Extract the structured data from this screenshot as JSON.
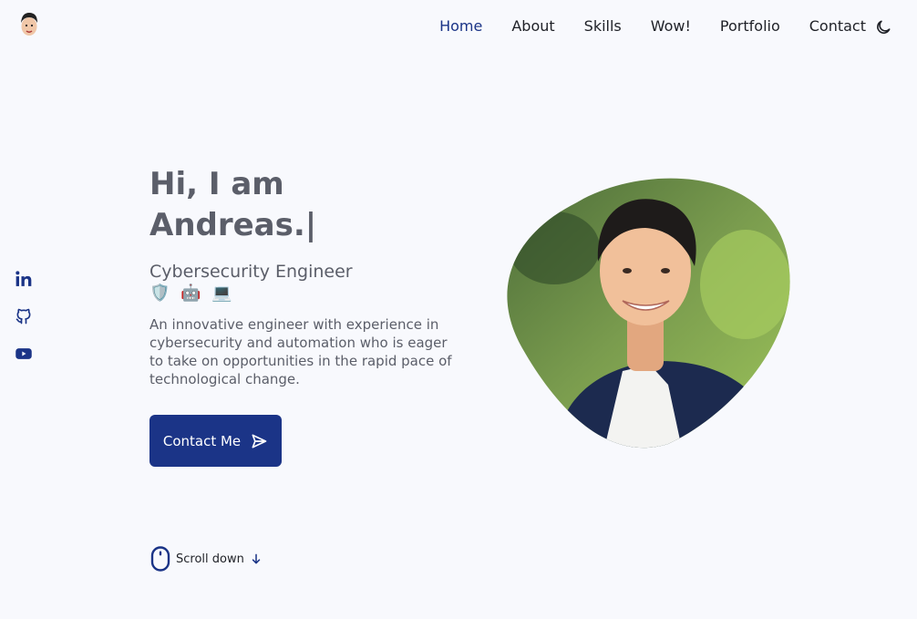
{
  "nav": {
    "items": [
      {
        "label": "Home",
        "active": true
      },
      {
        "label": "About",
        "active": false
      },
      {
        "label": "Skills",
        "active": false
      },
      {
        "label": "Wow!",
        "active": false
      },
      {
        "label": "Portfolio",
        "active": false
      },
      {
        "label": "Contact",
        "active": false
      }
    ],
    "theme_icon": "moon-icon"
  },
  "socials": [
    "linkedin-icon",
    "github-icon",
    "youtube-icon"
  ],
  "hero": {
    "greeting": "Hi, I am",
    "name": "Andreas.|",
    "subtitle": "Cybersecurity Engineer",
    "emojis": "🛡️ 🤖 💻",
    "description": "An innovative engineer with experience in cybersecurity and automation who is eager to take on opportunities in the rapid pace of technological change.",
    "button_label": "Contact Me"
  },
  "scroll": {
    "label": "Scroll down"
  },
  "colors": {
    "accent": "#1b3487",
    "background": "#f8f9fd",
    "text": "#5b5e69"
  }
}
